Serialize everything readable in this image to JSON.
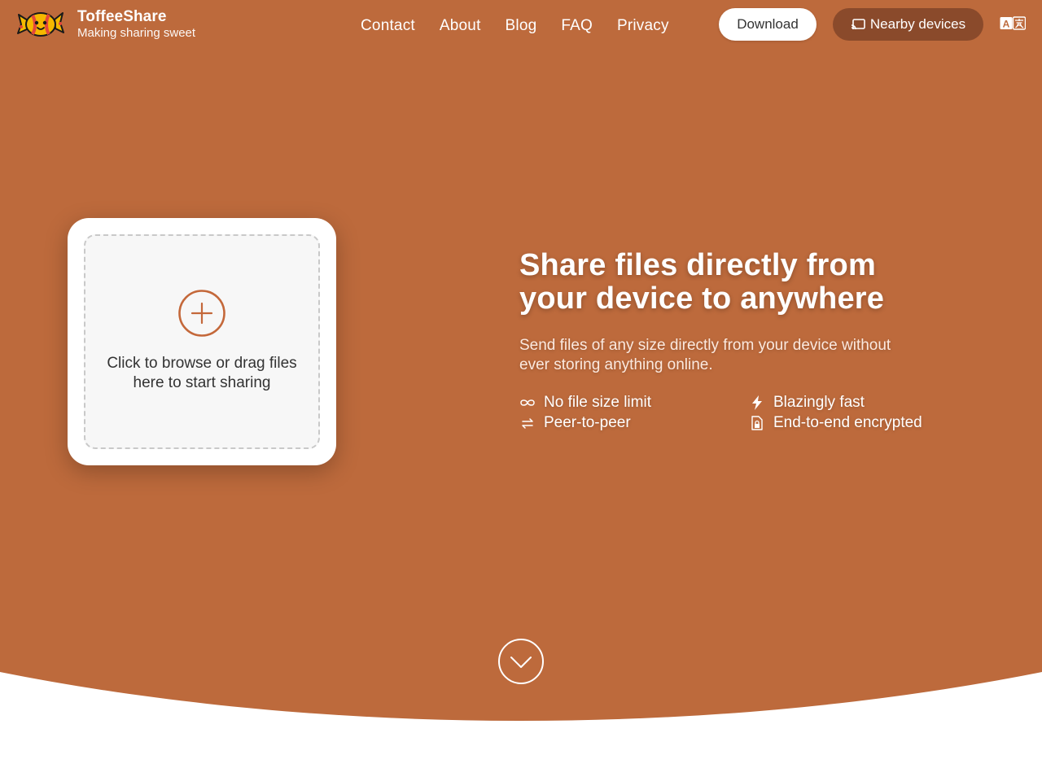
{
  "colors": {
    "hero_bg": "#bd6a3c",
    "accent": "#c4683a",
    "nearby_button": "#8a4a2b",
    "white": "#ffffff"
  },
  "header": {
    "brand_name": "ToffeeShare",
    "tagline": "Making sharing sweet",
    "nav": [
      "Contact",
      "About",
      "Blog",
      "FAQ",
      "Privacy"
    ],
    "download_label": "Download",
    "nearby_label": "Nearby devices"
  },
  "upload": {
    "prompt_line1": "Click to browse or drag files",
    "prompt_line2": "here to start sharing"
  },
  "hero": {
    "headline_line1": "Share files directly from",
    "headline_line2": "your device to anywhere",
    "subtext_line1": "Send files of any size directly from your device without",
    "subtext_line2": "ever storing anything online."
  },
  "features": [
    {
      "label": "No file size limit",
      "icon": "infinity-icon"
    },
    {
      "label": "Peer-to-peer",
      "icon": "swap-arrows-icon"
    },
    {
      "label": "Blazingly fast",
      "icon": "lightning-icon"
    },
    {
      "label": "End-to-end encrypted",
      "icon": "lock-file-icon"
    }
  ],
  "icons": {
    "logo": "candy-logo",
    "nearby": "cast-icon",
    "language": "translate-icon",
    "upload": "plus-circle-icon",
    "scroll": "chevron-down-circle-icon"
  }
}
